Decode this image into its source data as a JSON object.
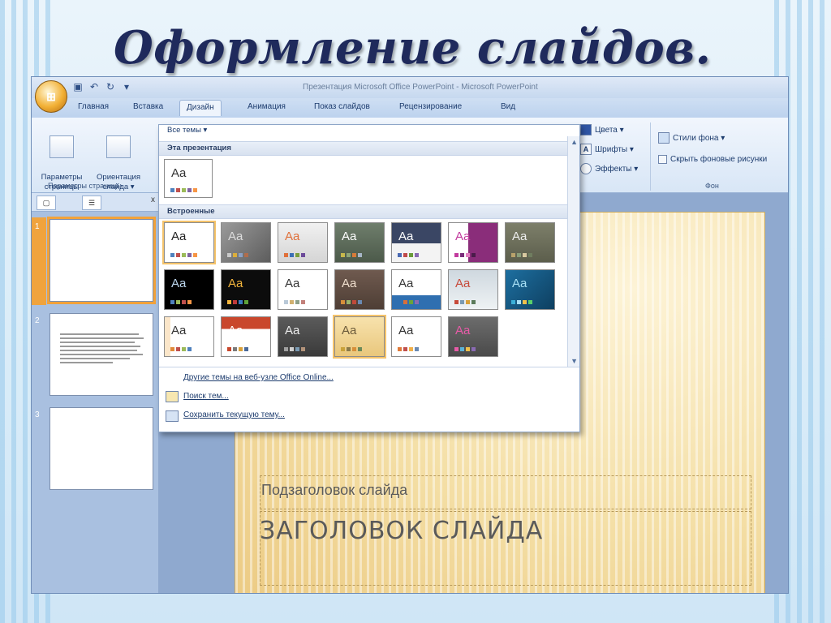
{
  "title": "Оформление слайдов.",
  "window_title": "Презентация Microsoft Office PowerPoint - Microsoft PowerPoint",
  "tabs": [
    "Главная",
    "Вставка",
    "Дизайн",
    "Анимация",
    "Показ слайдов",
    "Рецензирование",
    "Вид"
  ],
  "active_tab": "Дизайн",
  "ribbon": {
    "page_setup_label": "Параметры\nстраницы",
    "orientation_label": "Ориентация\nслайда ▾",
    "page_group": "Параметры страницы",
    "colors": "Цвета ▾",
    "fonts": "Шрифты ▾",
    "effects": "Эффекты ▾",
    "bg_styles": "Стили фона ▾",
    "hide_bg": "Скрыть фоновые рисунки",
    "bg_group": "Фон"
  },
  "gallery": {
    "header": "Все темы ▾",
    "section_current": "Эта презентация",
    "section_builtin": "Встроенные",
    "aa_label": "Aa",
    "links": [
      "Другие темы на веб-узле Office Online...",
      "Поиск тем...",
      "Сохранить текущую тему..."
    ]
  },
  "slide_numbers": [
    "1",
    "2",
    "3"
  ],
  "slide": {
    "subtitle": "Подзаголовок слайда",
    "heading": "ЗАГОЛОВОК СЛАЙДА"
  },
  "colors": {
    "title": "#1f2a5c",
    "accent": "#f0a33d"
  }
}
